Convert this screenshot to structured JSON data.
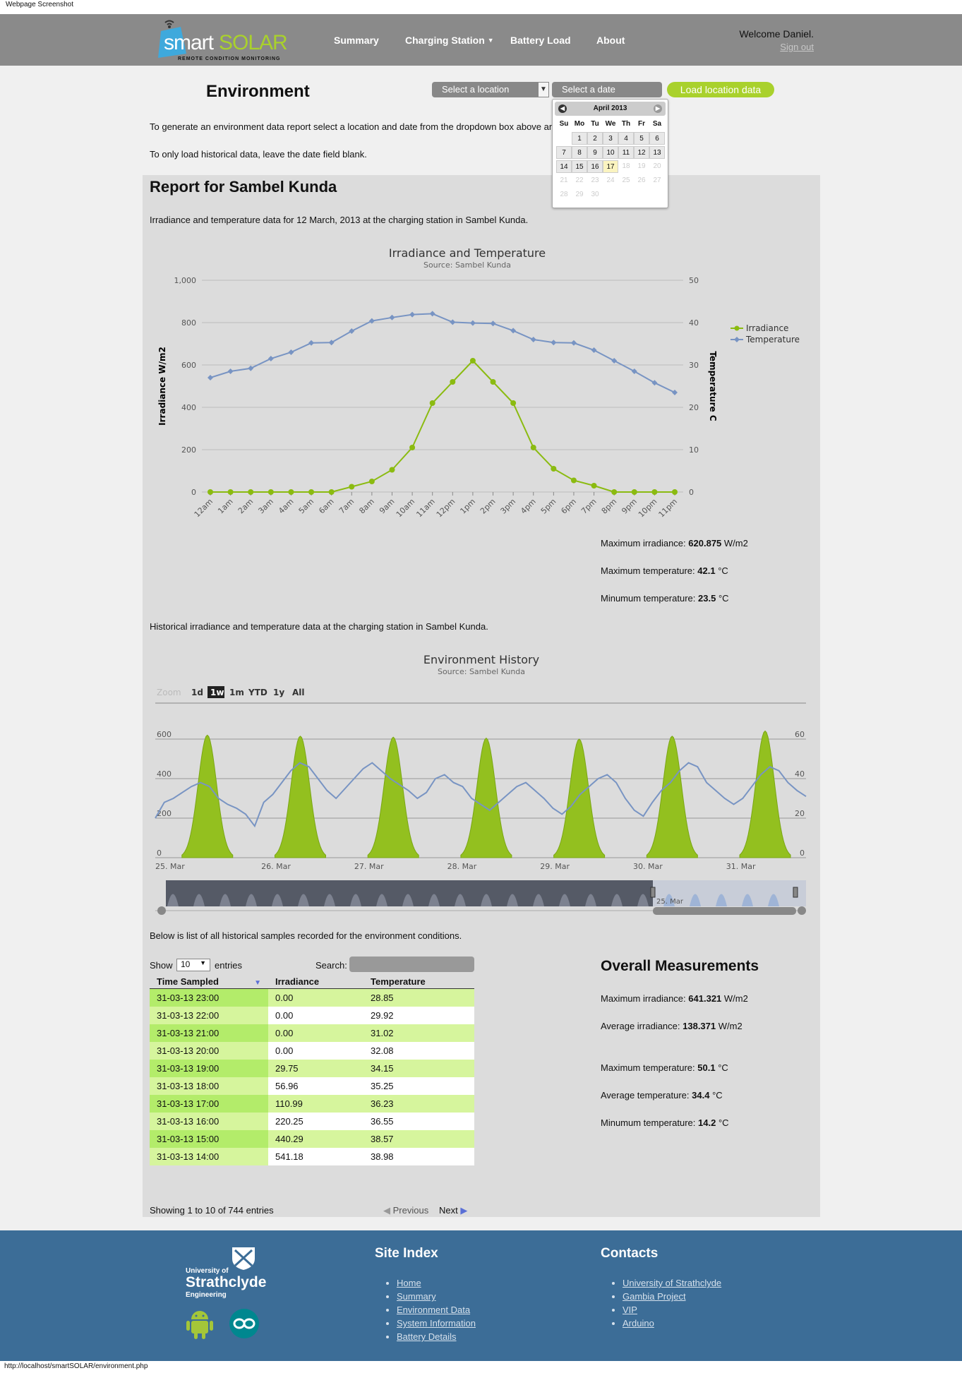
{
  "topbar": {
    "title": "Webpage Screenshot"
  },
  "header": {
    "logo_main": "smart",
    "logo_accent": "SOLAR",
    "logo_tagline": "REMOTE CONDITION MONITORING",
    "nav": [
      "Summary",
      "Charging Station",
      "Battery Load",
      "About"
    ],
    "welcome": "Welcome Daniel.",
    "signout": "Sign out"
  },
  "controls": {
    "title": "Environment",
    "location_placeholder": "Select a location",
    "date_placeholder": "Select a date",
    "load_button": "Load location data"
  },
  "calendar": {
    "month": "April 2013",
    "day_headers": [
      "Su",
      "Mo",
      "Tu",
      "We",
      "Th",
      "Fr",
      "Sa"
    ],
    "today": 17
  },
  "intro": {
    "line1": "To generate an environment data report select a location and date from the dropdown box above and",
    "line2": "To only load historical data, leave the date field blank."
  },
  "report": {
    "title": "Report for Sambel Kunda",
    "subtitle": "Irradiance and temperature data for 12 March, 2013 at the charging station in Sambel Kunda.",
    "history_text": "Historical irradiance and temperature data at the charging station in Sambel Kunda.",
    "samples_text": "Below is list of all historical samples recorded for the environment conditions."
  },
  "daily_stats": {
    "max_irr_label": "Maximum irradiance:",
    "max_irr": "620.875",
    "max_irr_unit": "W/m2",
    "max_temp_label": "Maximum temperature:",
    "max_temp": "42.1",
    "temp_unit": "°C",
    "min_temp_label": "Minumum temperature:",
    "min_temp": "23.5"
  },
  "chart_data": [
    {
      "type": "line",
      "title": "Irradiance and Temperature",
      "subtitle": "Source: Sambel Kunda",
      "categories": [
        "12am",
        "1am",
        "2am",
        "3am",
        "4am",
        "5am",
        "6am",
        "7am",
        "8am",
        "9am",
        "10am",
        "11am",
        "12pm",
        "1pm",
        "2pm",
        "3pm",
        "4pm",
        "5pm",
        "6pm",
        "7pm",
        "8pm",
        "9pm",
        "10pm",
        "11pm"
      ],
      "series": [
        {
          "name": "Irradiance",
          "axis": "left",
          "color": "#8bbb11",
          "values": [
            0,
            0,
            0,
            0,
            0,
            0,
            0,
            25,
            50,
            105,
            210,
            420,
            520,
            620,
            520,
            420,
            210,
            110,
            55,
            30,
            0,
            0,
            0,
            0
          ]
        },
        {
          "name": "Temperature",
          "axis": "right",
          "color": "#7894c3",
          "values": [
            27,
            28.5,
            29.2,
            31.5,
            33,
            35.2,
            35.3,
            38,
            40.4,
            41.2,
            41.9,
            42.1,
            40.1,
            39.9,
            39.8,
            38.1,
            36,
            35.3,
            35.2,
            33.5,
            31,
            28.5,
            25.8,
            23.5
          ]
        }
      ],
      "ylabel": "Irradiance W/m2",
      "y2label": "Temperature C",
      "ylim": [
        0,
        1000
      ],
      "y2lim": [
        0,
        50
      ],
      "yticks": [
        "0",
        "200",
        "400",
        "600",
        "800",
        "1,000"
      ],
      "y2ticks": [
        "0",
        "10",
        "20",
        "30",
        "40",
        "50"
      ],
      "legend": "right"
    },
    {
      "type": "area",
      "title": "Environment History",
      "subtitle": "Source: Sambel Kunda",
      "xticks": [
        "25. Mar",
        "26. Mar",
        "27. Mar",
        "28. Mar",
        "29. Mar",
        "30. Mar",
        "31. Mar"
      ],
      "ylim": [
        0,
        600
      ],
      "y2lim": [
        0,
        60
      ],
      "yticks": [
        "0",
        "200",
        "400",
        "600"
      ],
      "y2ticks": [
        "0",
        "20",
        "40",
        "60"
      ],
      "daily_peak_irradiance": [
        620,
        615,
        610,
        605,
        600,
        615,
        641
      ],
      "temp_curve": [
        20,
        28,
        30,
        33,
        36,
        38,
        36,
        30,
        27,
        25,
        22,
        16,
        28,
        32,
        38,
        44,
        48,
        46,
        40,
        34,
        30,
        35,
        40,
        45,
        48,
        44,
        40,
        37,
        34,
        30,
        33,
        40,
        42,
        38,
        36,
        30,
        27,
        24,
        28,
        32,
        36,
        38,
        34,
        30,
        25,
        22,
        26,
        32,
        36,
        40,
        42,
        38,
        30,
        24,
        21,
        28,
        34,
        38,
        44,
        48,
        46,
        38,
        34,
        30,
        27,
        30,
        36,
        42,
        46,
        44,
        38,
        34,
        31
      ]
    }
  ],
  "range_selector": {
    "zoom_label": "Zoom",
    "buttons": [
      "1d",
      "1w",
      "1m",
      "YTD",
      "1y",
      "All"
    ],
    "active": "1w",
    "navigator_label": "25. Mar"
  },
  "table": {
    "show_label": "Show",
    "entries_value": "10",
    "entries_label": "entries",
    "search_label": "Search:",
    "headers": [
      "Time Sampled",
      "Irradiance",
      "Temperature"
    ],
    "rows": [
      [
        "31-03-13 23:00",
        "0.00",
        "28.85"
      ],
      [
        "31-03-13 22:00",
        "0.00",
        "29.92"
      ],
      [
        "31-03-13 21:00",
        "0.00",
        "31.02"
      ],
      [
        "31-03-13 20:00",
        "0.00",
        "32.08"
      ],
      [
        "31-03-13 19:00",
        "29.75",
        "34.15"
      ],
      [
        "31-03-13 18:00",
        "56.96",
        "35.25"
      ],
      [
        "31-03-13 17:00",
        "110.99",
        "36.23"
      ],
      [
        "31-03-13 16:00",
        "220.25",
        "36.55"
      ],
      [
        "31-03-13 15:00",
        "440.29",
        "38.57"
      ],
      [
        "31-03-13 14:00",
        "541.18",
        "38.98"
      ]
    ],
    "info": "Showing 1 to 10 of 744 entries",
    "previous": "Previous",
    "next": "Next"
  },
  "overall": {
    "title": "Overall Measurements",
    "max_irr_label": "Maximum irradiance:",
    "max_irr": "641.321",
    "irr_unit": "W/m2",
    "avg_irr_label": "Average irradiance:",
    "avg_irr": "138.371",
    "max_temp_label": "Maximum temperature:",
    "max_temp": "50.1",
    "temp_unit": "°C",
    "avg_temp_label": "Average temperature:",
    "avg_temp": "34.4",
    "min_temp_label": "Minumum temperature:",
    "min_temp": "14.2"
  },
  "footer": {
    "uni_line1": "University of",
    "uni_line2": "Strathclyde",
    "uni_line3": "Engineering",
    "site_index_title": "Site Index",
    "site_index": [
      "Home",
      "Summary",
      "Environment Data",
      "System Information",
      "Battery Details"
    ],
    "contacts_title": "Contacts",
    "contacts": [
      "University of Strathclyde",
      "Gambia Project",
      "VIP",
      "Arduino"
    ]
  },
  "statusbar": {
    "url": "http://localhost/smartSOLAR/environment.php"
  }
}
